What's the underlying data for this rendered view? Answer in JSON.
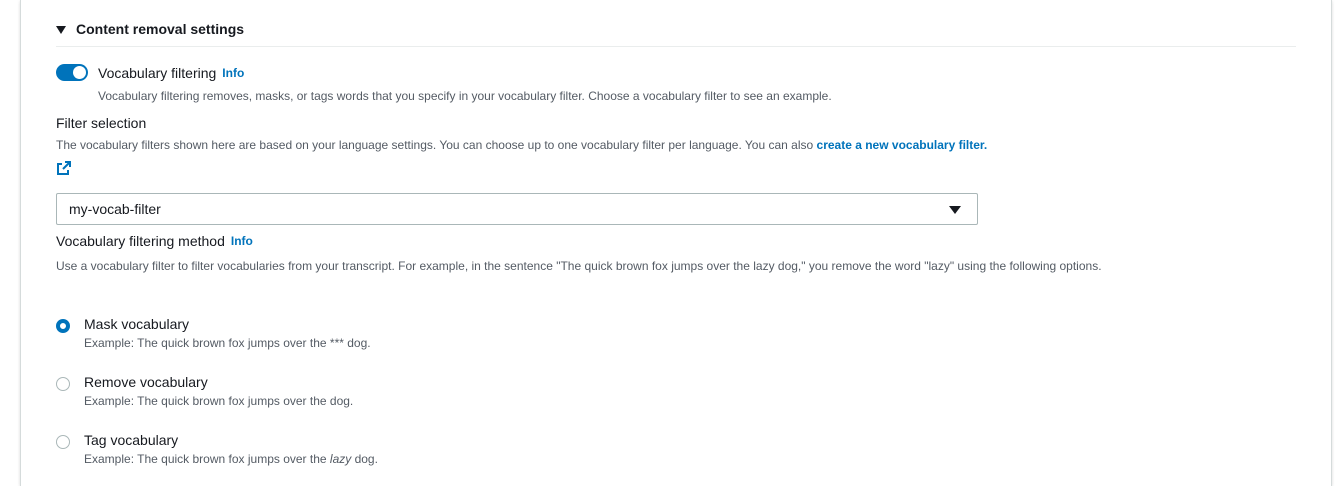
{
  "section": {
    "title": "Content removal settings"
  },
  "vocab_filtering": {
    "label": "Vocabulary filtering",
    "info": "Info",
    "description": "Vocabulary filtering removes, masks, or tags words that you specify in your vocabulary filter. Choose a vocabulary filter to see an example.",
    "enabled": true
  },
  "filter_selection": {
    "label": "Filter selection",
    "description": "The vocabulary filters shown here are based on your language settings. You can choose up to one vocabulary filter per language. You can also ",
    "link_text": "create a new vocabulary filter.",
    "selected_value": "my-vocab-filter"
  },
  "method": {
    "label": "Vocabulary filtering method",
    "info": "Info",
    "description": "Use a vocabulary filter to filter vocabularies from your transcript. For example, in the sentence \"The quick brown fox jumps over the lazy dog,\" you remove the word \"lazy\" using the following options.",
    "options": [
      {
        "title": "Mask vocabulary",
        "example": "Example: The quick brown fox jumps over the *** dog.",
        "checked": true
      },
      {
        "title": "Remove vocabulary",
        "example": "Example: The quick brown fox jumps over the dog.",
        "checked": false
      },
      {
        "title": "Tag vocabulary",
        "example_prefix": "Example: The quick brown fox jumps over the ",
        "example_em": "lazy",
        "example_suffix": " dog.",
        "checked": false
      }
    ]
  },
  "colors": {
    "accent": "#0073bb",
    "text": "#16191f",
    "secondary_text": "#545b64"
  }
}
